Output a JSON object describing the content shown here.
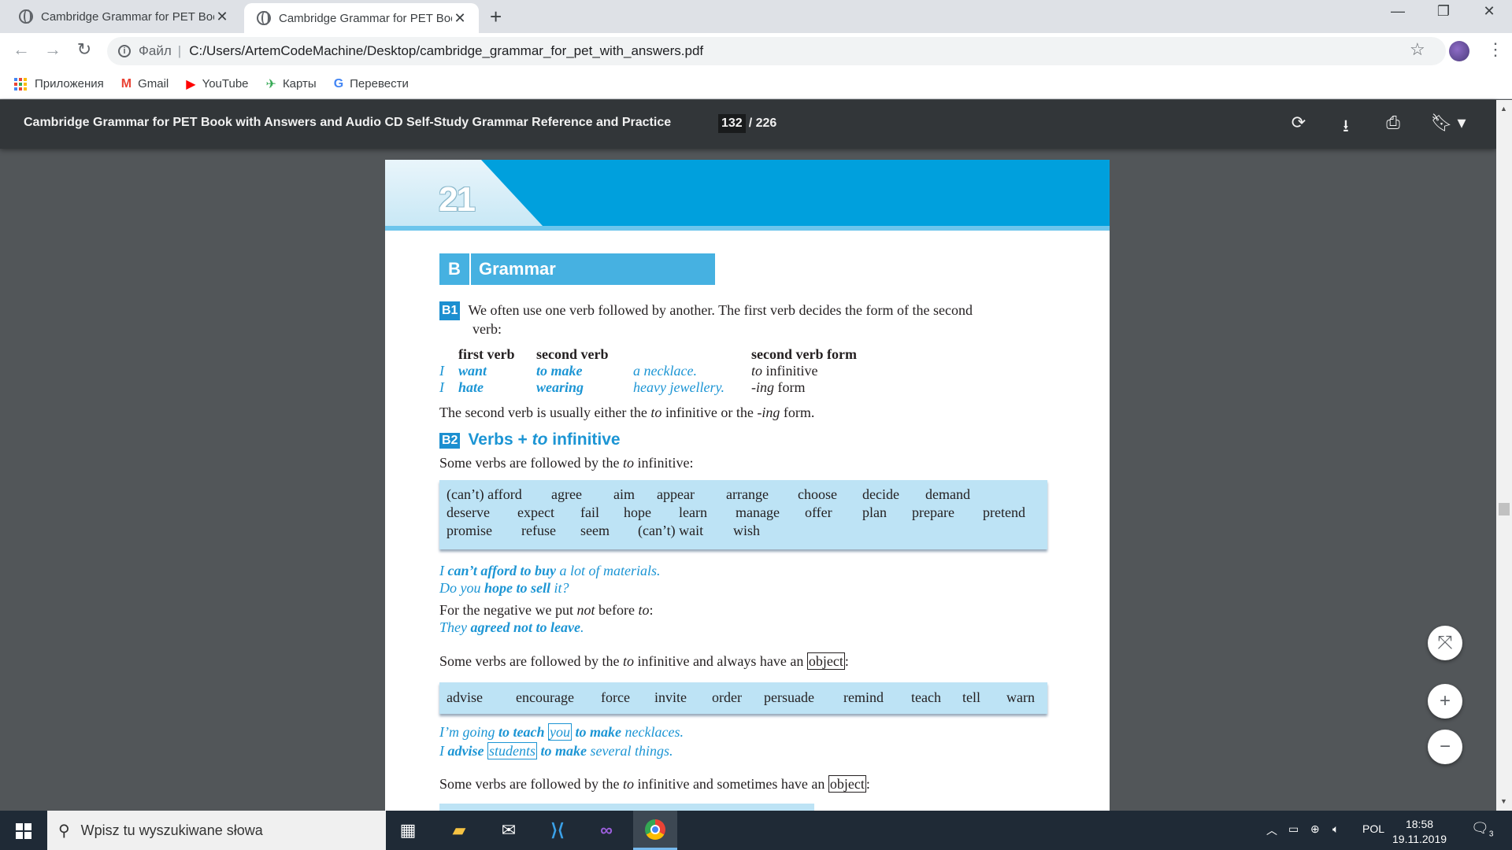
{
  "browser": {
    "tabs": [
      {
        "title": "Cambridge Grammar for PET Boo",
        "close": "✕"
      },
      {
        "title": "Cambridge Grammar for PET Boo",
        "close": "✕"
      }
    ],
    "new_tab": "+",
    "window_controls": {
      "minimize": "—",
      "maximize": "❐",
      "close": "✕"
    },
    "nav": {
      "back": "←",
      "forward": "→",
      "reload": "↻"
    },
    "address": {
      "protocol_label": "Файл",
      "separator": "|",
      "url": "C:/Users/ArtemCodeMachine/Desktop/cambridge_grammar_for_pet_with_answers.pdf"
    },
    "bookmarks": [
      {
        "label": "Приложения",
        "icon": "apps-grid-icon"
      },
      {
        "label": "Gmail",
        "icon": "gmail-icon",
        "glyph": "M",
        "color": "#ea4335"
      },
      {
        "label": "YouTube",
        "icon": "youtube-icon",
        "glyph": "▶",
        "color": "#ff0000"
      },
      {
        "label": "Карты",
        "icon": "maps-icon",
        "glyph": "✈",
        "color": "#34a853"
      },
      {
        "label": "Перевести",
        "icon": "translate-icon",
        "glyph": "G",
        "color": "#4285f4"
      }
    ]
  },
  "pdf_viewer": {
    "title": "Cambridge Grammar for PET Book with Answers and Audio CD Self-Study Grammar Reference and Practice",
    "current_page": "132",
    "total_pages": "/ 226",
    "icons": [
      "rotate-icon",
      "download-icon",
      "print-icon",
      "bookmark-icon"
    ]
  },
  "page": {
    "unit_number": "21",
    "section_letter": "B",
    "section_title": "Grammar",
    "b1": {
      "tag": "B1",
      "intro_line1": "We often use one verb followed by another. The first verb decides the form of the second",
      "intro_line2": "verb:",
      "headers": {
        "first": "first verb",
        "second": "second verb",
        "form": "second verb form"
      },
      "rows": [
        {
          "subject": "I",
          "first": "want",
          "second": "to make",
          "rest": "a necklace.",
          "form_em": "to",
          "form_rest": " infinitive"
        },
        {
          "subject": "I",
          "first": "hate",
          "second": "wearing",
          "rest": "heavy jewellery.",
          "form_em": "-ing",
          "form_rest": " form"
        }
      ],
      "summary_a": "The second verb is usually either the ",
      "summary_em1": "to",
      "summary_b": " infinitive or the ",
      "summary_em2": "-ing",
      "summary_c": " form."
    },
    "b2": {
      "tag": "B2",
      "heading_a": "Verbs + ",
      "heading_em": "to",
      "heading_b": " infinitive",
      "intro_a": "Some verbs are followed by the ",
      "intro_em": "to",
      "intro_b": " infinitive:",
      "verbs_row1": [
        "(can’t) afford",
        "agree",
        "aim",
        "appear",
        "arrange",
        "choose",
        "decide",
        "demand"
      ],
      "verbs_row2": [
        "deserve",
        "expect",
        "fail",
        "hope",
        "learn",
        "manage",
        "offer",
        "plan",
        "prepare",
        "pretend"
      ],
      "verbs_row3": [
        "promise",
        "refuse",
        "seem",
        "(can’t) wait",
        "wish"
      ],
      "ex1_a": "I ",
      "ex1_b": "can’t afford to buy",
      "ex1_c": " a lot of materials.",
      "ex2_a": "Do you ",
      "ex2_b": "hope to sell",
      "ex2_c": " it?",
      "neg_a": "For the negative we put ",
      "neg_em1": "not",
      "neg_b": " before ",
      "neg_em2": "to",
      "neg_c": ":",
      "neg_ex_a": "They ",
      "neg_ex_b": "agreed not to leave",
      "neg_ex_c": ".",
      "obj_a": "Some verbs are followed by the ",
      "obj_em": "to",
      "obj_b": " infinitive and always have an ",
      "obj_box": "object",
      "obj_c": ":",
      "obj_verbs": [
        "advise",
        "encourage",
        "force",
        "invite",
        "order",
        "persuade",
        "remind",
        "teach",
        "tell",
        "warn"
      ],
      "oex1_a": "I’m going ",
      "oex1_b": "to teach",
      "oex1_box": "you",
      "oex1_c": "to make",
      "oex1_d": " necklaces.",
      "oex2_a": "I ",
      "oex2_b": "advise",
      "oex2_box": "students",
      "oex2_c": "to make",
      "oex2_d": " several things.",
      "some_a": "Some verbs are followed by the ",
      "some_em": "to",
      "some_b": " infinitive and sometimes have an ",
      "some_box": "object",
      "some_c": ":"
    }
  },
  "zoom_controls": {
    "fit": "⤧",
    "zoom_in": "+",
    "zoom_out": "−"
  },
  "taskbar": {
    "search_placeholder": "Wpisz tu wyszukiwane słowa",
    "apps": [
      "task-view-icon",
      "file-explorer-icon",
      "mail-icon",
      "vscode-icon",
      "visual-studio-icon",
      "chrome-icon"
    ],
    "tray_lang": "POL",
    "time": "18:58",
    "date": "19.11.2019",
    "notifications": "3"
  }
}
